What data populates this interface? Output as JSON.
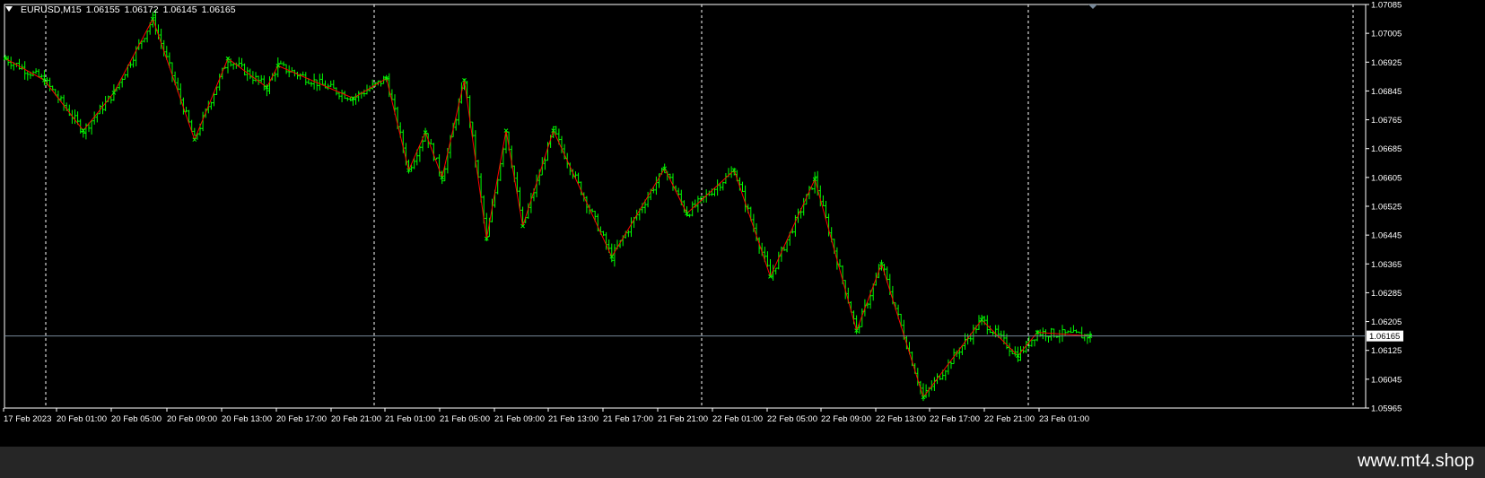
{
  "header": {
    "symbol": "EURUSD,M15",
    "open": "1.06155",
    "high": "1.06172",
    "low": "1.06145",
    "close": "1.06165"
  },
  "watermark": "www.mt4.shop",
  "colors": {
    "background": "#000000",
    "frame": "#ffffff",
    "bars": "#00ff00",
    "zigzag": "#ff0000",
    "bid_line": "#778899",
    "footer": "#262626"
  },
  "chart_data": {
    "type": "line",
    "ylim": [
      1.05965,
      1.07085
    ],
    "y_ticks": [
      "1.07085",
      "1.07005",
      "1.06925",
      "1.06845",
      "1.06765",
      "1.06685",
      "1.06605",
      "1.06525",
      "1.06445",
      "1.06365",
      "1.06285",
      "1.06205",
      "1.06125",
      "1.06045",
      "1.05965"
    ],
    "x_ticks": [
      "17 Feb 2023",
      "20 Feb 01:00",
      "20 Feb 05:00",
      "20 Feb 09:00",
      "20 Feb 13:00",
      "20 Feb 17:00",
      "20 Feb 21:00",
      "21 Feb 01:00",
      "21 Feb 05:00",
      "21 Feb 09:00",
      "21 Feb 13:00",
      "21 Feb 17:00",
      "21 Feb 21:00",
      "22 Feb 01:00",
      "22 Feb 05:00",
      "22 Feb 09:00",
      "22 Feb 13:00",
      "22 Feb 17:00",
      "22 Feb 21:00",
      "23 Feb 01:00"
    ],
    "current_price": "1.06165",
    "current_price_value": 1.06165,
    "series": [
      {
        "type": "zigzag",
        "bar_index": [
          0,
          14,
          28,
          39,
          53,
          68,
          80,
          94,
          98,
          125,
          137,
          145,
          151,
          157,
          165,
          173,
          180,
          186,
          197,
          218,
          237,
          245,
          262,
          275,
          291,
          306,
          315,
          330,
          351,
          364,
          371,
          390
        ],
        "values": [
          1.06935,
          1.06875,
          1.06735,
          1.0684,
          1.07045,
          1.0671,
          1.06935,
          1.06855,
          1.06915,
          1.06825,
          1.0688,
          1.06625,
          1.0673,
          1.06605,
          1.06875,
          1.06435,
          1.06735,
          1.0647,
          1.06735,
          1.06385,
          1.0663,
          1.06505,
          1.06625,
          1.0633,
          1.066,
          1.0618,
          1.06365,
          1.05995,
          1.0621,
          1.0611,
          1.06175,
          1.06165
        ]
      }
    ]
  }
}
